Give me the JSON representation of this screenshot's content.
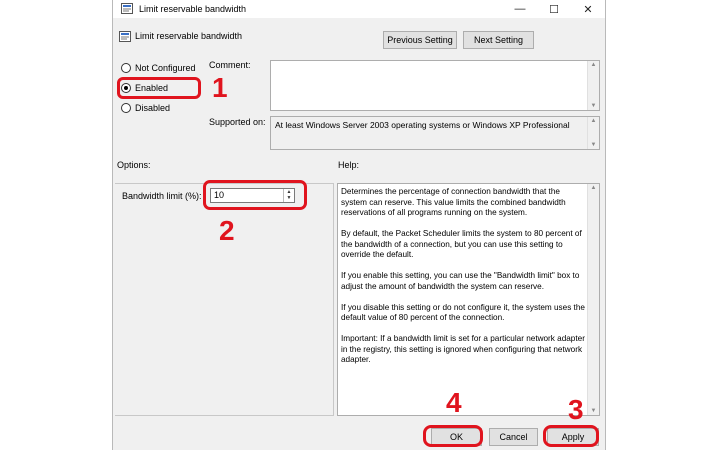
{
  "window": {
    "title": "Limit reservable bandwidth",
    "minimize": "—",
    "maximize": "☐",
    "close": "✕"
  },
  "header": {
    "title": "Limit reservable bandwidth",
    "prev_button": "Previous Setting",
    "next_button": "Next Setting"
  },
  "state": {
    "options": [
      {
        "label": "Not Configured",
        "checked": false
      },
      {
        "label": "Enabled",
        "checked": true
      },
      {
        "label": "Disabled",
        "checked": false
      }
    ]
  },
  "comment": {
    "label": "Comment:",
    "value": ""
  },
  "supported": {
    "label": "Supported on:",
    "value": "At least Windows Server 2003 operating systems or Windows XP Professional"
  },
  "options_section": {
    "label": "Options:",
    "bandwidth_label": "Bandwidth limit (%):",
    "bandwidth_value": "10"
  },
  "help": {
    "label": "Help:",
    "text": "Determines the percentage of connection bandwidth that the system can reserve. This value limits the combined bandwidth reservations of all programs running on the system.\n\nBy default, the Packet Scheduler limits the system to 80 percent of the bandwidth of a connection, but you can use this setting to override the default.\n\nIf you enable this setting, you can use the \"Bandwidth limit\" box to adjust the amount of bandwidth the system can reserve.\n\nIf you disable this setting or do not configure it, the system uses the default value of 80 percent of the connection.\n\nImportant: If a bandwidth limit is set for a particular network adapter in the registry, this setting is ignored when configuring that network adapter."
  },
  "footer": {
    "ok": "OK",
    "cancel": "Cancel",
    "apply": "Apply"
  },
  "annotations": {
    "n1": "1",
    "n2": "2",
    "n3": "3",
    "n4": "4",
    "color": "#e0141e"
  }
}
